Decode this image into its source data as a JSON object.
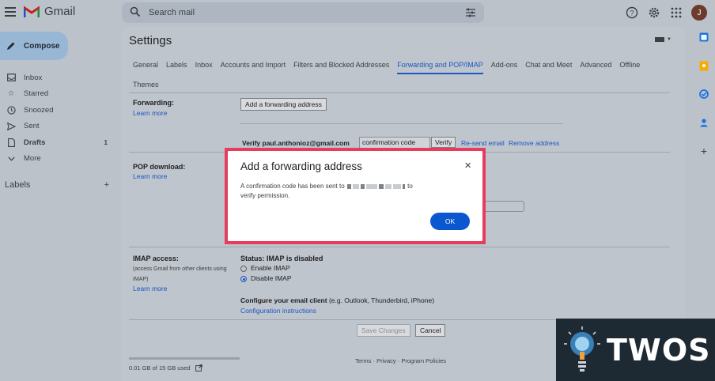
{
  "app": {
    "name": "Gmail",
    "avatar_letter": "J"
  },
  "search": {
    "placeholder": "Search mail"
  },
  "sidebar": {
    "compose_label": "Compose",
    "items": [
      {
        "label": "Inbox",
        "icon": "inbox-icon",
        "count": ""
      },
      {
        "label": "Starred",
        "icon": "star-icon",
        "count": ""
      },
      {
        "label": "Snoozed",
        "icon": "clock-icon",
        "count": ""
      },
      {
        "label": "Sent",
        "icon": "send-icon",
        "count": ""
      },
      {
        "label": "Drafts",
        "icon": "draft-icon",
        "count": "1"
      },
      {
        "label": "More",
        "icon": "chevron-down-icon",
        "count": ""
      }
    ],
    "labels_heading": "Labels",
    "labels_add": "+",
    "storage": "0.01 GB of 15 GB used"
  },
  "settings": {
    "title": "Settings",
    "tabs": [
      "General",
      "Labels",
      "Inbox",
      "Accounts and Import",
      "Filters and Blocked Addresses",
      "Forwarding and POP/IMAP",
      "Add-ons",
      "Chat and Meet",
      "Advanced",
      "Offline",
      "Themes"
    ],
    "active_tab": "Forwarding and POP/IMAP",
    "forwarding": {
      "label": "Forwarding:",
      "learn_more": "Learn more",
      "add_button": "Add a forwarding address",
      "verify_text": "Verify paul.anthonioz@gmail.com",
      "code_value": "confirmation code",
      "verify_button": "Verify",
      "resend": "Re-send email",
      "remove": "Remove address"
    },
    "pop": {
      "label": "POP download:",
      "learn_more": "Learn more"
    },
    "imap": {
      "label": "IMAP access:",
      "sub1": "(access Gmail from other clients using",
      "sub2": "IMAP)",
      "learn_more": "Learn more",
      "status": "Status: IMAP is disabled",
      "enable": "Enable IMAP",
      "disable": "Disable IMAP",
      "enabled": false,
      "configure_bold": "Configure your email client",
      "configure_rest": " (e.g. Outlook, Thunderbird, iPhone)",
      "instructions": "Configuration instructions"
    },
    "save_button": "Save Changes",
    "cancel_button": "Cancel",
    "footer": "Terms · Privacy · Program Policies"
  },
  "dialog": {
    "title": "Add a forwarding address",
    "body_start": "A confirmation code has been sent to",
    "body_end": "to",
    "body_line2": "verify permission.",
    "ok": "OK",
    "close_icon": "×",
    "highlight_color": "#e73c5e"
  },
  "watermark": {
    "text": "TWOS"
  },
  "colors": {
    "accent": "#1a56c4",
    "ok_button": "#0b57d0"
  }
}
